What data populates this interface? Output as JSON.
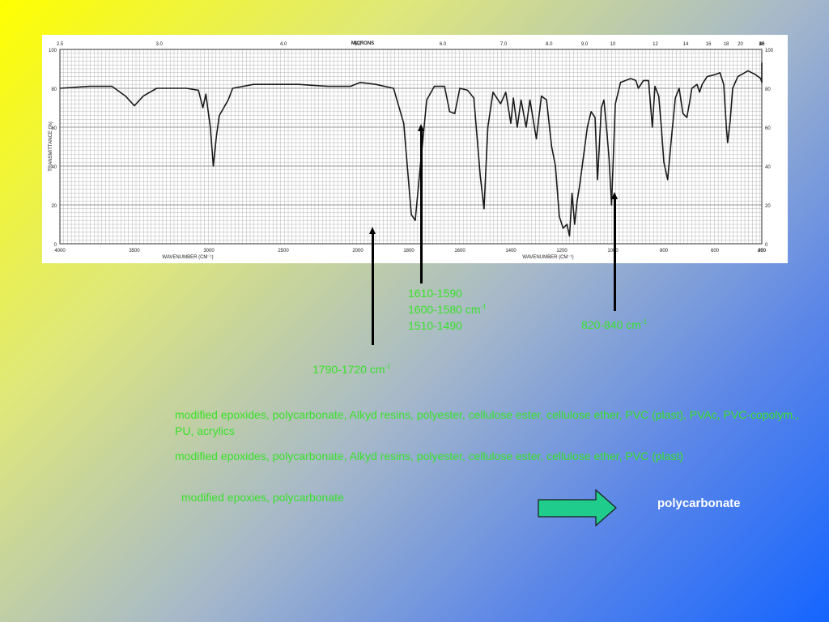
{
  "chart_data": {
    "type": "line",
    "xlabel": "WAVENUMBER (CM⁻¹)",
    "ylabel": "TRANSMITTANCE (%)",
    "top_axis_label": "MICRONS",
    "xlim": [
      4000,
      250
    ],
    "ylim": [
      0,
      100
    ],
    "grid": true,
    "x_ticks": [
      "4000",
      "3500",
      "3000",
      "2500",
      "2000",
      "1800",
      "1600",
      "1400",
      "1200",
      "1000",
      "800",
      "600",
      "400",
      "250"
    ],
    "x_tick_values": [
      4000,
      3500,
      3000,
      2500,
      2000,
      1800,
      1600,
      1400,
      1200,
      1000,
      800,
      600,
      400,
      250
    ],
    "micron_ticks": [
      "2.5",
      "3.0",
      "4.0",
      "5.0",
      "6.0",
      "7.0",
      "8.0",
      "9.0",
      "10",
      "12",
      "14",
      "16",
      "18",
      "20",
      "25",
      "30",
      "35",
      "40"
    ],
    "micron_tick_values": [
      2.5,
      3.0,
      4.0,
      5.0,
      6.0,
      7.0,
      8.0,
      9.0,
      10,
      12,
      14,
      16,
      18,
      20,
      25,
      30,
      35,
      40
    ],
    "y_ticks": [
      "0",
      "20",
      "40",
      "60",
      "80",
      "100"
    ],
    "y_tick_values": [
      0,
      20,
      40,
      60,
      80,
      100
    ],
    "series": [
      {
        "points": [
          [
            4000,
            80
          ],
          [
            3800,
            81
          ],
          [
            3650,
            81
          ],
          [
            3560,
            76
          ],
          [
            3500,
            71
          ],
          [
            3440,
            76
          ],
          [
            3350,
            80
          ],
          [
            3150,
            80
          ],
          [
            3070,
            79
          ],
          [
            3040,
            70
          ],
          [
            3020,
            77
          ],
          [
            2990,
            60
          ],
          [
            2970,
            40
          ],
          [
            2950,
            55
          ],
          [
            2930,
            66
          ],
          [
            2900,
            70
          ],
          [
            2870,
            74
          ],
          [
            2840,
            80
          ],
          [
            2700,
            82
          ],
          [
            2400,
            82
          ],
          [
            2200,
            81
          ],
          [
            2050,
            81
          ],
          [
            1990,
            83
          ],
          [
            1930,
            82
          ],
          [
            1860,
            80
          ],
          [
            1820,
            62
          ],
          [
            1790,
            15
          ],
          [
            1775,
            12
          ],
          [
            1755,
            40
          ],
          [
            1730,
            74
          ],
          [
            1700,
            81
          ],
          [
            1660,
            81
          ],
          [
            1640,
            68
          ],
          [
            1620,
            67
          ],
          [
            1600,
            80
          ],
          [
            1570,
            79
          ],
          [
            1545,
            75
          ],
          [
            1520,
            35
          ],
          [
            1505,
            18
          ],
          [
            1490,
            60
          ],
          [
            1470,
            78
          ],
          [
            1440,
            72
          ],
          [
            1420,
            78
          ],
          [
            1400,
            62
          ],
          [
            1390,
            75
          ],
          [
            1375,
            60
          ],
          [
            1360,
            74
          ],
          [
            1340,
            60
          ],
          [
            1325,
            74
          ],
          [
            1300,
            54
          ],
          [
            1280,
            76
          ],
          [
            1260,
            74
          ],
          [
            1240,
            50
          ],
          [
            1225,
            40
          ],
          [
            1210,
            14
          ],
          [
            1195,
            8
          ],
          [
            1180,
            10
          ],
          [
            1170,
            4
          ],
          [
            1160,
            26
          ],
          [
            1150,
            10
          ],
          [
            1140,
            22
          ],
          [
            1130,
            30
          ],
          [
            1100,
            60
          ],
          [
            1085,
            68
          ],
          [
            1070,
            65
          ],
          [
            1060,
            33
          ],
          [
            1045,
            70
          ],
          [
            1035,
            74
          ],
          [
            1025,
            60
          ],
          [
            1015,
            44
          ],
          [
            1005,
            20
          ],
          [
            990,
            72
          ],
          [
            970,
            83
          ],
          [
            930,
            85
          ],
          [
            910,
            84
          ],
          [
            900,
            80
          ],
          [
            880,
            84
          ],
          [
            860,
            84
          ],
          [
            845,
            60
          ],
          [
            835,
            81
          ],
          [
            820,
            76
          ],
          [
            810,
            60
          ],
          [
            800,
            42
          ],
          [
            785,
            33
          ],
          [
            770,
            55
          ],
          [
            755,
            75
          ],
          [
            740,
            80
          ],
          [
            725,
            67
          ],
          [
            710,
            65
          ],
          [
            700,
            72
          ],
          [
            690,
            80
          ],
          [
            670,
            82
          ],
          [
            660,
            78
          ],
          [
            650,
            82
          ],
          [
            630,
            86
          ],
          [
            600,
            87
          ],
          [
            580,
            88
          ],
          [
            565,
            82
          ],
          [
            555,
            60
          ],
          [
            550,
            52
          ],
          [
            540,
            63
          ],
          [
            530,
            80
          ],
          [
            510,
            86
          ],
          [
            470,
            89
          ],
          [
            440,
            87
          ],
          [
            420,
            85
          ],
          [
            410,
            83
          ],
          [
            390,
            88
          ],
          [
            350,
            92
          ],
          [
            300,
            93
          ],
          [
            260,
            92
          ],
          [
            250,
            92
          ]
        ]
      }
    ],
    "annotations": [
      {
        "lines": [
          "1610-1590",
          "1600-1580 cm",
          "1510-1490"
        ],
        "sup_line": 1,
        "sup": "-1",
        "wavenumber": 1600
      },
      {
        "lines": [
          "1790-1720 cm"
        ],
        "sup_line": 0,
        "sup": "-1",
        "wavenumber": 1780
      },
      {
        "lines": [
          "820-840 cm"
        ],
        "sup_line": 0,
        "sup": "-1",
        "wavenumber": 790
      }
    ]
  },
  "text_blocks": [
    "modified epoxides, polycarbonate, Alkyd resins, polyester, cellulose ester, cellulose ether, PVC (plast), PVAc, PVC-copolym., PU, acrylics",
    "modified epoxides, polycarbonate, Alkyd resins, polyester, cellulose ester, cellulose ether, PVC (plast)",
    "modified epoxies, polycarbonate"
  ],
  "result": {
    "label": "polycarbonate",
    "arrow_color": "#1fcc8c"
  },
  "colors": {
    "label_text": "#39e22a",
    "result_text": "#ffffff",
    "spectrum_line": "#1a1a1a",
    "grid_line": "#9a9a9a"
  }
}
